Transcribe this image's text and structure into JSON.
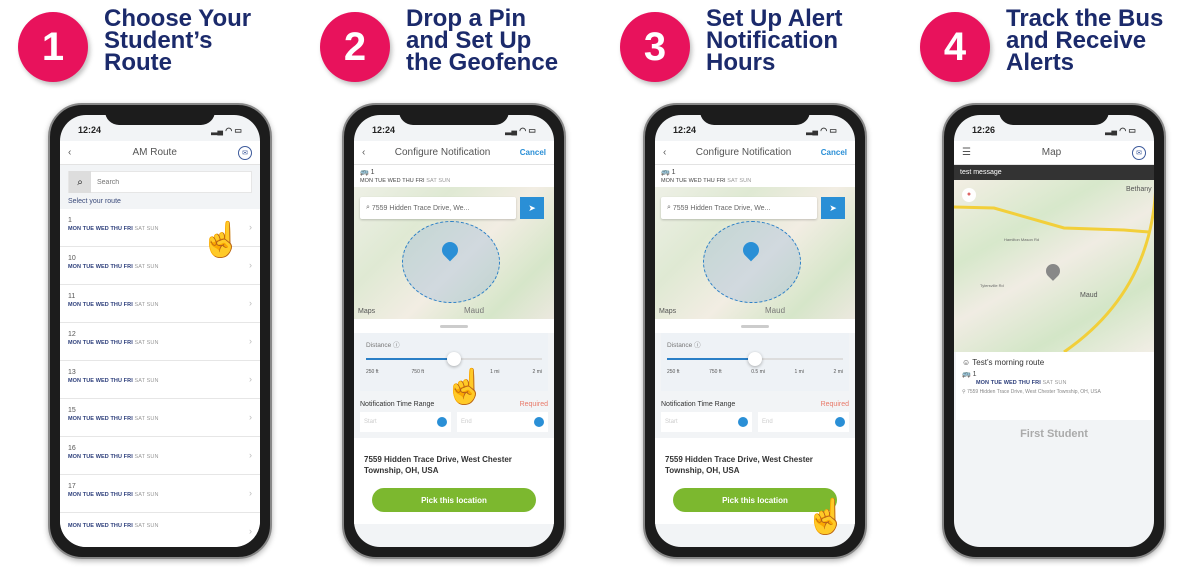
{
  "steps": [
    {
      "number": "1",
      "title": "Choose Your\nStudent’s\nRoute"
    },
    {
      "number": "2",
      "title": "Drop a Pin\nand Set Up\nthe Geofence"
    },
    {
      "number": "3",
      "title": "Set Up Alert\nNotification\nHours"
    },
    {
      "number": "4",
      "title": "Track the Bus\nand Receive\nAlerts"
    }
  ],
  "colors": {
    "step_circle": "#e8125c",
    "heading": "#1b2a6b",
    "accent_blue": "#2a8fd6",
    "button_green": "#7cb82f"
  },
  "screen1": {
    "time": "12:24",
    "title": "AM Route",
    "search_placeholder": "Search",
    "select_label": "Select your route",
    "weekdays": "MON TUE WED THU FRI",
    "weekend": "SAT SUN",
    "routes": [
      "1",
      "10",
      "11",
      "12",
      "13",
      "15",
      "16",
      "17",
      ""
    ]
  },
  "screen2": {
    "time": "12:24",
    "title": "Configure Notification",
    "cancel": "Cancel",
    "route": "1",
    "weekdays": "MON TUE WED THU FRI",
    "weekend": "SAT SUN",
    "address_field": "7559 Hidden Trace Drive, We...",
    "maps_label": "Maps",
    "town": "Maud",
    "distance_label": "Distance",
    "ticks": [
      "250 ft",
      "750 ft",
      "",
      "1 mi",
      "2 mi"
    ],
    "slider_percent": 50,
    "time_range_label": "Notification Time Range",
    "required": "Required",
    "start_placeholder": "Start",
    "end_placeholder": "End",
    "address_line1": "7559 Hidden Trace Drive, West Chester",
    "address_line2": "Township, OH, USA",
    "pick_button": "Pick this location"
  },
  "screen3": {
    "time": "12:24",
    "title": "Configure Notification",
    "cancel": "Cancel",
    "route": "1",
    "weekdays": "MON TUE WED THU FRI",
    "weekend": "SAT SUN",
    "address_field": "7559 Hidden Trace Drive, We...",
    "maps_label": "Maps",
    "town": "Maud",
    "distance_label": "Distance",
    "ticks": [
      "250 ft",
      "750 ft",
      "0.5 mi",
      "1 mi",
      "2 mi"
    ],
    "slider_percent": 50,
    "time_range_label": "Notification Time Range",
    "required": "Required",
    "start_placeholder": "Start",
    "end_placeholder": "End",
    "address_line1": "7559 Hidden Trace Drive, West Chester",
    "address_line2": "Township, OH, USA",
    "pick_button": "Pick this location"
  },
  "screen4": {
    "time": "12:26",
    "title": "Map",
    "banner": "test message",
    "town": "Maud",
    "place": "Bethany",
    "road1": "Hamilton Mason Rd",
    "road2": "Tylersville Rd",
    "route_name": "Test’s morning route",
    "route": "1",
    "weekdays": "MON TUE WED THU FRI",
    "weekend": "SAT SUN",
    "address": "7559 Hidden Trace Drive, West Chester Township, OH, USA",
    "brand": "First Student"
  }
}
